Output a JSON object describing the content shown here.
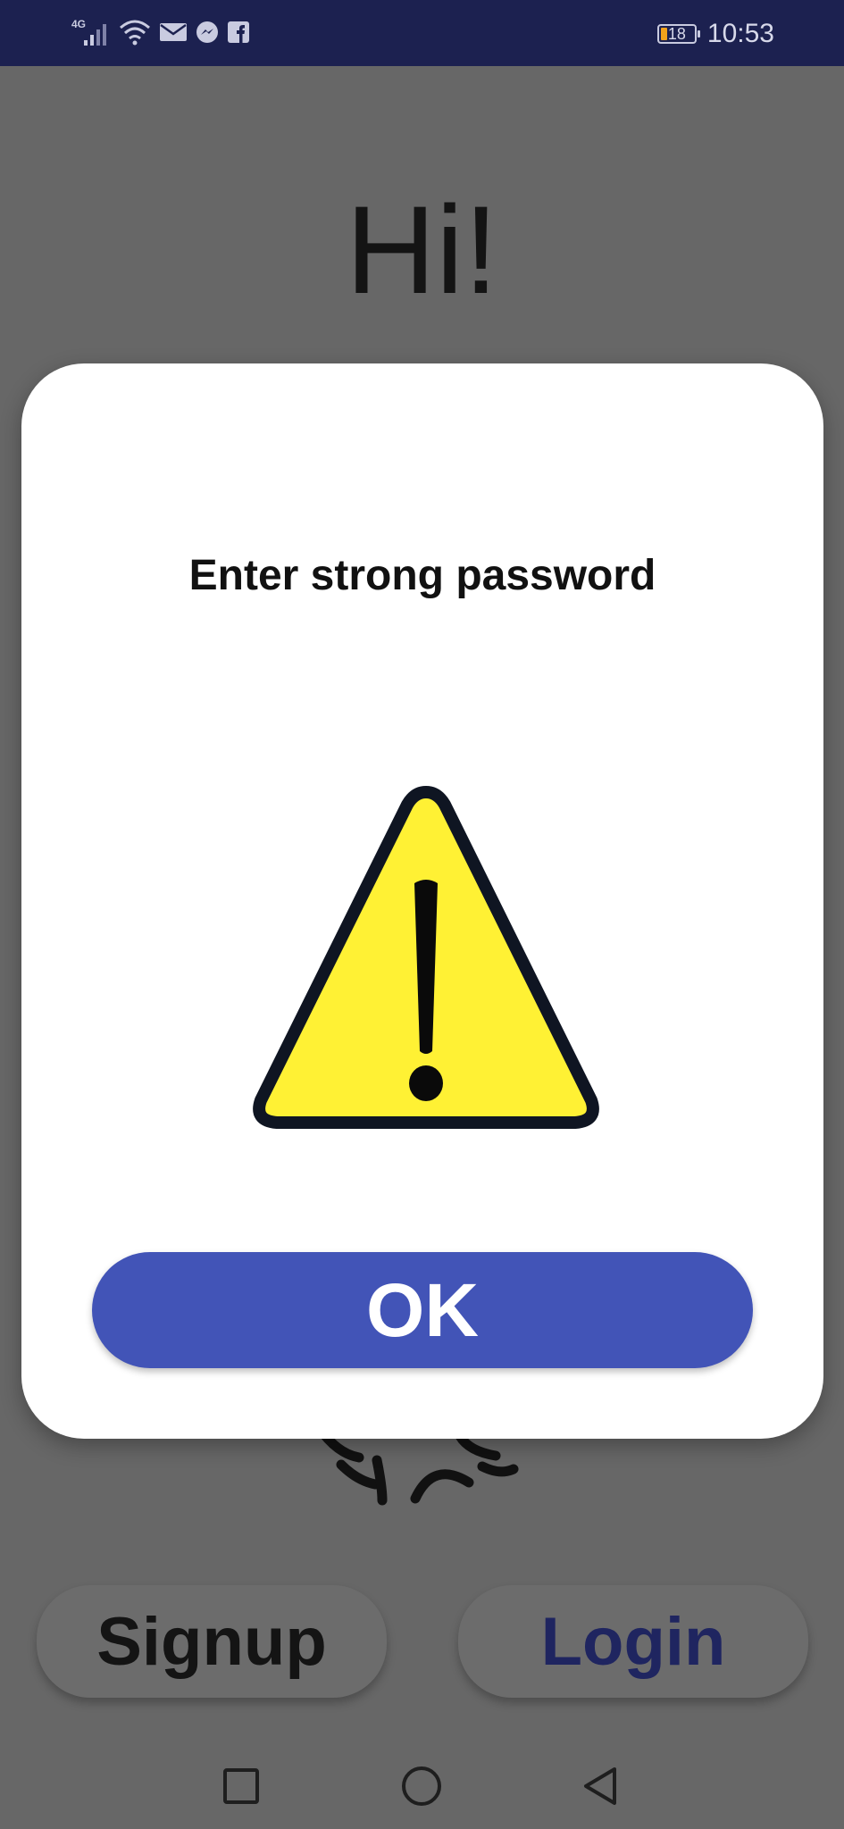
{
  "status_bar": {
    "network_label": "4G",
    "time": "10:53",
    "battery_level": "18",
    "accent_color": "#1c2150",
    "icons": [
      "signal-icon",
      "wifi-icon",
      "mail-icon",
      "messenger-icon",
      "facebook-icon",
      "battery-icon"
    ]
  },
  "screen": {
    "greeting": "Hi!",
    "signup_label": "Signup",
    "login_label": "Login"
  },
  "dialog": {
    "message": "Enter strong password",
    "icon": "warning-icon",
    "ok_label": "OK",
    "button_color": "#4254b7"
  },
  "nav_bar": {
    "items": [
      "recent-apps-icon",
      "home-icon",
      "back-icon"
    ]
  }
}
